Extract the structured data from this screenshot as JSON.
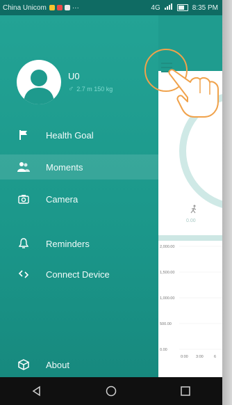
{
  "status_bar": {
    "carrier": "China Unicom",
    "network": "4G",
    "time": "8:35 PM"
  },
  "drawer": {
    "user": {
      "name": "U0",
      "stats": "2.7 m 150 kg"
    },
    "menu": [
      {
        "label": "Health Goal",
        "icon": "flag-icon"
      },
      {
        "label": "Moments",
        "icon": "people-icon",
        "active": true
      },
      {
        "label": "Camera",
        "icon": "camera-icon"
      },
      {
        "label": "Reminders",
        "icon": "bell-icon"
      },
      {
        "label": "Connect Device",
        "icon": "link-icon"
      }
    ],
    "about_label": "About"
  },
  "main": {
    "step_value": "0.00",
    "chart_data": {
      "type": "bar",
      "y_ticks": [
        "2,000.00",
        "1,500.00",
        "1,000.00",
        "500.00",
        "0.00"
      ],
      "x_ticks": [
        "0:00",
        "3:00",
        "6"
      ],
      "ylim": [
        0,
        2000
      ],
      "values": []
    }
  },
  "colors": {
    "drawer_bg": "#1e9a8d",
    "accent_light": "#7fd9cf",
    "highlight": "#f0a24b"
  }
}
